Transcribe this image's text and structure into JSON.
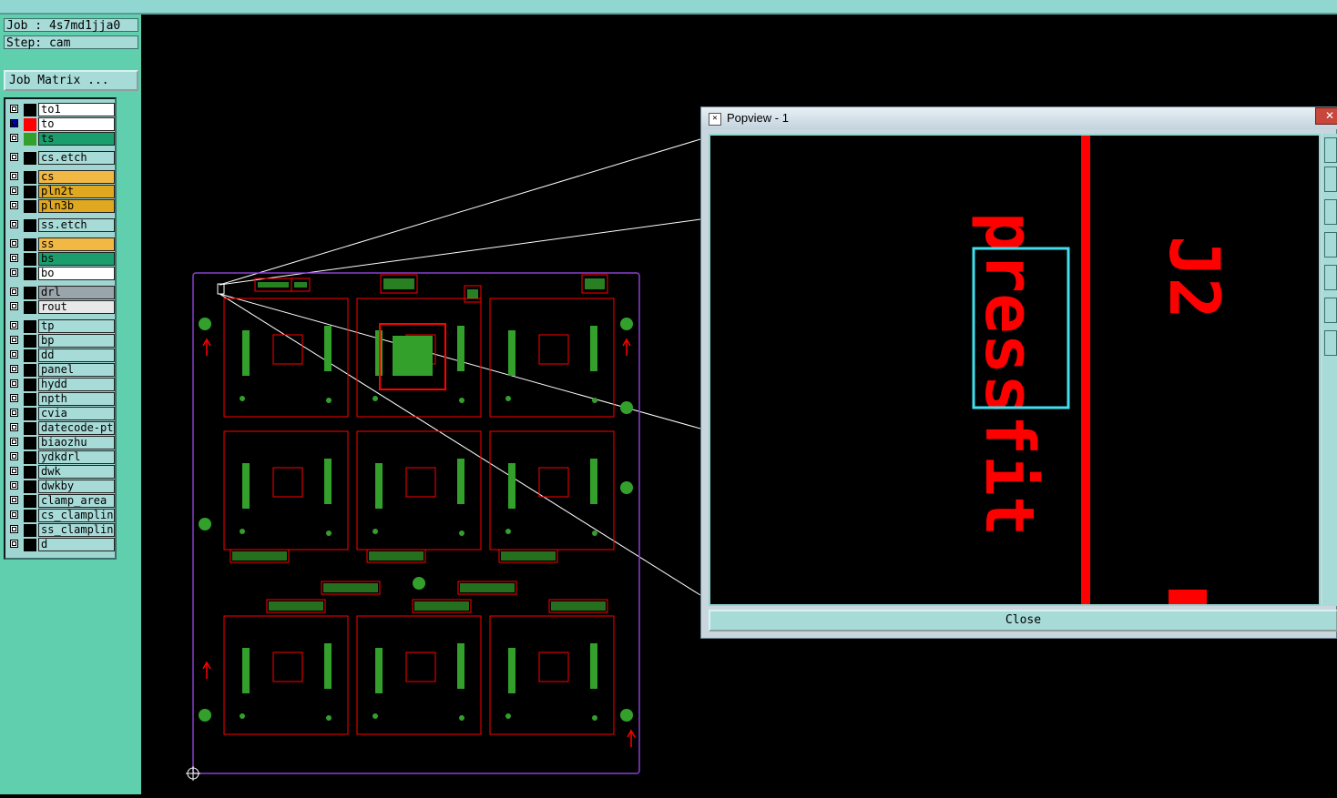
{
  "header": {
    "job": "Job : 4s7md1jja0",
    "step": "Step: cam"
  },
  "toolbar": {
    "job_matrix": "Job Matrix ..."
  },
  "layers": [
    {
      "name": "to1",
      "color": "#ffffff",
      "swatch": "#000000",
      "checked": false
    },
    {
      "name": "to",
      "color": "#ffffff",
      "swatch": "#ff0000",
      "checked": true
    },
    {
      "name": "ts",
      "color": "#1a9e6e",
      "swatch": "#33a02c",
      "checked": false
    },
    {
      "name": "cs.etch",
      "color": "#a7dbd8",
      "swatch": "#000000",
      "checked": false
    },
    {
      "name": "cs",
      "color": "#f2b844",
      "swatch": "#000000",
      "checked": false
    },
    {
      "name": "pln2t",
      "color": "#e0a820",
      "swatch": "#000000",
      "checked": false
    },
    {
      "name": "pln3b",
      "color": "#e0a820",
      "swatch": "#000000",
      "checked": false
    },
    {
      "name": "ss.etch",
      "color": "#a7dbd8",
      "swatch": "#000000",
      "checked": false
    },
    {
      "name": "ss",
      "color": "#f2b844",
      "swatch": "#000000",
      "checked": false
    },
    {
      "name": "bs",
      "color": "#1a9e6e",
      "swatch": "#000000",
      "checked": false
    },
    {
      "name": "bo",
      "color": "#ffffff",
      "swatch": "#000000",
      "checked": false
    },
    {
      "name": "drl",
      "color": "#9aa5ab",
      "swatch": "#000000",
      "checked": false
    },
    {
      "name": "rout",
      "color": "#e8e8e8",
      "swatch": "#000000",
      "checked": false
    },
    {
      "name": "tp",
      "color": "#a7dbd8",
      "swatch": "#000000",
      "checked": false
    },
    {
      "name": "bp",
      "color": "#a7dbd8",
      "swatch": "#000000",
      "checked": false
    },
    {
      "name": "dd",
      "color": "#a7dbd8",
      "swatch": "#000000",
      "checked": false
    },
    {
      "name": "panel",
      "color": "#a7dbd8",
      "swatch": "#000000",
      "checked": false
    },
    {
      "name": "hydd",
      "color": "#a7dbd8",
      "swatch": "#000000",
      "checked": false
    },
    {
      "name": "npth",
      "color": "#a7dbd8",
      "swatch": "#000000",
      "checked": false
    },
    {
      "name": "cvia",
      "color": "#a7dbd8",
      "swatch": "#000000",
      "checked": false
    },
    {
      "name": "datecode-pto",
      "color": "#a7dbd8",
      "swatch": "#000000",
      "checked": false
    },
    {
      "name": "biaozhu",
      "color": "#a7dbd8",
      "swatch": "#000000",
      "checked": false
    },
    {
      "name": "ydkdrl",
      "color": "#a7dbd8",
      "swatch": "#000000",
      "checked": false
    },
    {
      "name": "dwk",
      "color": "#a7dbd8",
      "swatch": "#000000",
      "checked": false
    },
    {
      "name": "dwkby",
      "color": "#a7dbd8",
      "swatch": "#000000",
      "checked": false
    },
    {
      "name": "clamp_area",
      "color": "#a7dbd8",
      "swatch": "#000000",
      "checked": false
    },
    {
      "name": "cs_clampline",
      "color": "#a7dbd8",
      "swatch": "#000000",
      "checked": false
    },
    {
      "name": "ss_clampline",
      "color": "#a7dbd8",
      "swatch": "#000000",
      "checked": false
    },
    {
      "name": "d",
      "color": "#a7dbd8",
      "swatch": "#000000",
      "checked": false
    }
  ],
  "popup": {
    "title": "Popview - 1",
    "close_label": "Close",
    "silkscreen_text": "pressfit",
    "refdes": "J2"
  },
  "colors": {
    "silk": "#ff0000",
    "pad": "#33a02c",
    "outline": "#8a3fd1",
    "highlight": "#40e0f0"
  }
}
